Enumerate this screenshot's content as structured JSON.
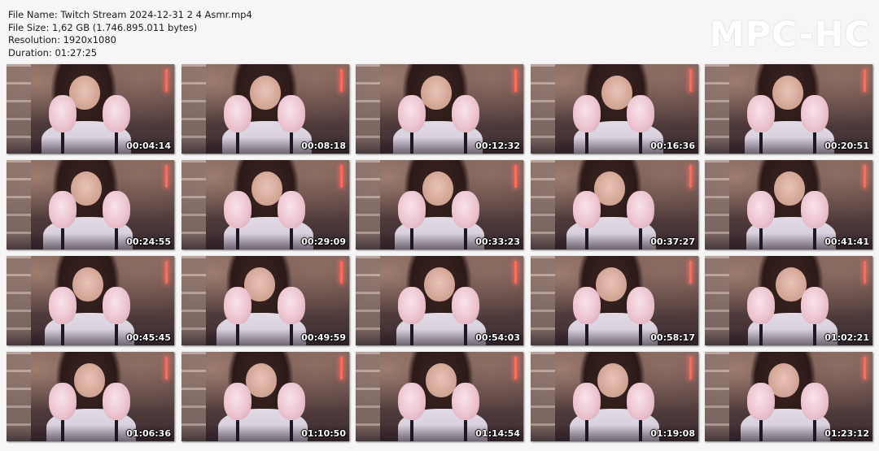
{
  "meta": {
    "file_name": "File Name: Twitch Stream 2024-12-31 2 4 Asmr.mp4",
    "file_size": "File Size: 1,62 GB (1.746.895.011 bytes)",
    "resolution": "Resolution: 1920x1080",
    "duration": "Duration: 01:27:25"
  },
  "brand": {
    "logo_text": "MPC-HC"
  },
  "thumbnails": [
    "00:04:14",
    "00:08:18",
    "00:12:32",
    "00:16:36",
    "00:20:51",
    "00:24:55",
    "00:29:09",
    "00:33:23",
    "00:37:27",
    "00:41:41",
    "00:45:45",
    "00:49:59",
    "00:54:03",
    "00:58:17",
    "01:02:21",
    "01:06:36",
    "01:10:50",
    "01:14:54",
    "01:19:08",
    "01:23:12"
  ],
  "colors": {
    "background": "#f6f6f6",
    "led_accent": "#ff6a5a",
    "timestamp_text": "#ffffff"
  }
}
